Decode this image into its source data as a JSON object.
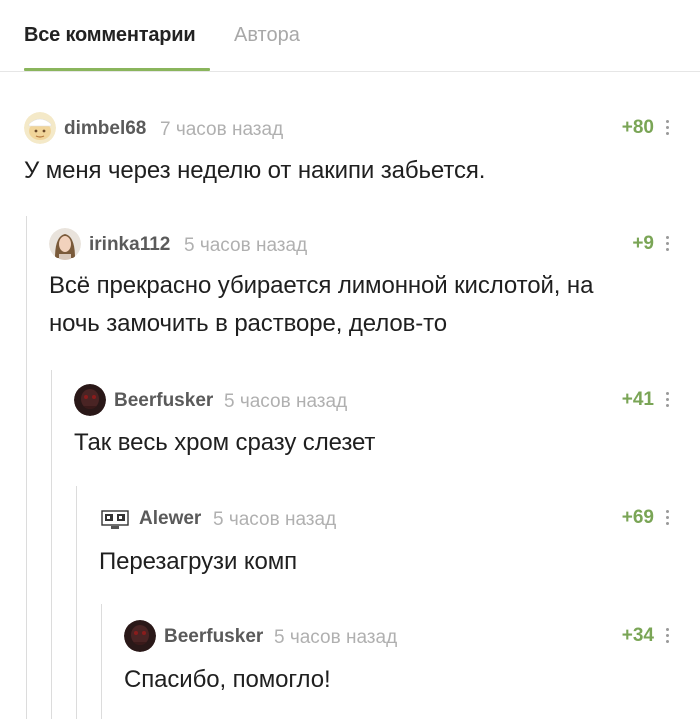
{
  "tabs": {
    "all_comments": "Все комментарии",
    "author": "Автора"
  },
  "comments": [
    {
      "username": "dimbel68",
      "time": "7 часов назад",
      "rating": "+80",
      "text": "У меня через неделю от накипи забьется.",
      "avatar": "cartoon-face-avatar"
    },
    {
      "username": "irinka112",
      "time": "5 часов назад",
      "rating": "+9",
      "text": "Всё прекрасно убирается лимонной кислотой, на ночь замочить в растворе, делов-то",
      "avatar": "photo-avatar"
    },
    {
      "username": "Beerfusker",
      "time": "5 часов назад",
      "rating": "+41",
      "text": "Так весь хром сразу слезет",
      "avatar": "dark-photo-avatar"
    },
    {
      "username": "Alewer",
      "time": "5 часов назад",
      "rating": "+69",
      "text": "Перезагрузи комп",
      "avatar": "pixel-face-avatar"
    },
    {
      "username": "Beerfusker",
      "time": "5 часов назад",
      "rating": "+34",
      "text": "Спасибо, помогло!",
      "avatar": "dark-photo-avatar"
    }
  ],
  "colors": {
    "accent": "#8ab55c",
    "rating": "#7aa556",
    "username": "#5a5a5a",
    "time": "#b0b0b0",
    "thread_line": "#dcdcdc"
  }
}
